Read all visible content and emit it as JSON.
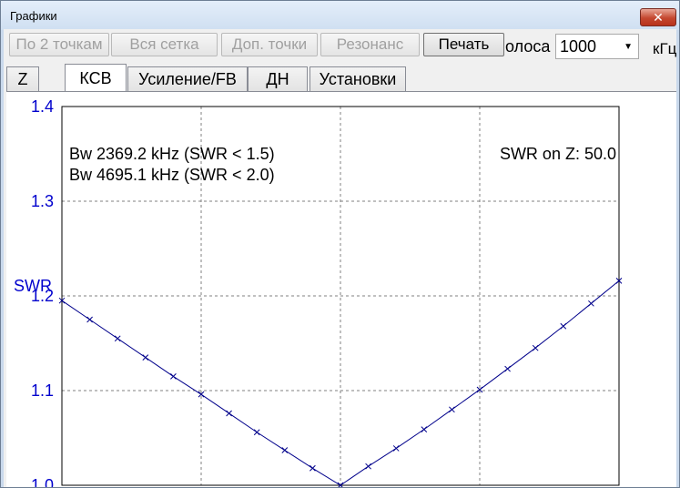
{
  "window": {
    "title": "Графики",
    "close_glyph": "✕"
  },
  "toolbar": {
    "buttons": [
      {
        "label": "По 2 точкам",
        "enabled": false
      },
      {
        "label": "Вся сетка",
        "enabled": false
      },
      {
        "label": "Доп. точки",
        "enabled": false
      },
      {
        "label": "Резонанс",
        "enabled": false
      },
      {
        "label": "Печать",
        "enabled": true
      }
    ],
    "band_label": "олоса",
    "band_value": "1000",
    "band_unit": "кГц"
  },
  "tabs": [
    {
      "label": "Z",
      "selected": false
    },
    {
      "label": "КСВ",
      "selected": true
    },
    {
      "label": "Усиление/FB",
      "selected": false
    },
    {
      "label": "ДН",
      "selected": false
    },
    {
      "label": "Установки",
      "selected": false
    }
  ],
  "colors": {
    "curve": "#00008b",
    "axis_labels": "#0000cd",
    "grid": "#808080"
  },
  "chart_data": {
    "type": "line",
    "ylabel": "SWR",
    "xlabel": "",
    "xlim": [
      145.0,
      146.0
    ],
    "ylim": [
      1.0,
      1.4
    ],
    "x_ticks": [
      "145.0",
      "145.25",
      "145.5",
      "145.75",
      "146.0"
    ],
    "y_ticks": [
      "1.0",
      "1.1",
      "1.2",
      "1.3",
      "1.4"
    ],
    "grid": true,
    "annotations": [
      "Bw 2369.2 kHz (SWR < 1.5)",
      "Bw 4695.1 kHz (SWR < 2.0)",
      "SWR on Z: 50.0"
    ],
    "series": [
      {
        "x": [
          145.0,
          145.05,
          145.1,
          145.15,
          145.2,
          145.25,
          145.3,
          145.35,
          145.4,
          145.45,
          145.5,
          145.55,
          145.6,
          145.65,
          145.7,
          145.75,
          145.8,
          145.85,
          145.9,
          145.95,
          146.0
        ],
        "y": [
          1.195,
          1.175,
          1.155,
          1.135,
          1.115,
          1.096,
          1.076,
          1.056,
          1.037,
          1.018,
          1.0,
          1.02,
          1.039,
          1.059,
          1.08,
          1.101,
          1.123,
          1.145,
          1.168,
          1.192,
          1.216
        ]
      }
    ]
  }
}
